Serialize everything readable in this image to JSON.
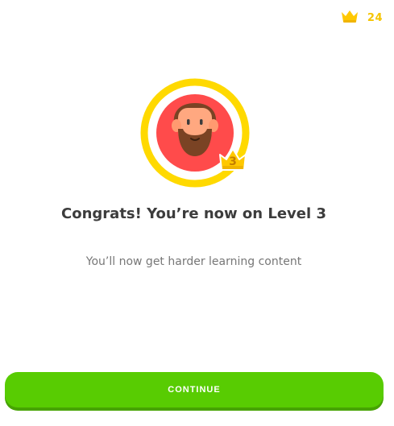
{
  "header": {
    "crown_count": "24",
    "crown_icon": "crown-icon"
  },
  "avatar": {
    "level": "3",
    "ring_color": "#ffd900",
    "background_color": "#ff4b4b"
  },
  "main": {
    "title": "Congrats! You’re now on Level 3",
    "subtitle": "You’ll now get harder learning content"
  },
  "footer": {
    "continue_label": "CONTINUE",
    "button_color": "#58cc02"
  }
}
